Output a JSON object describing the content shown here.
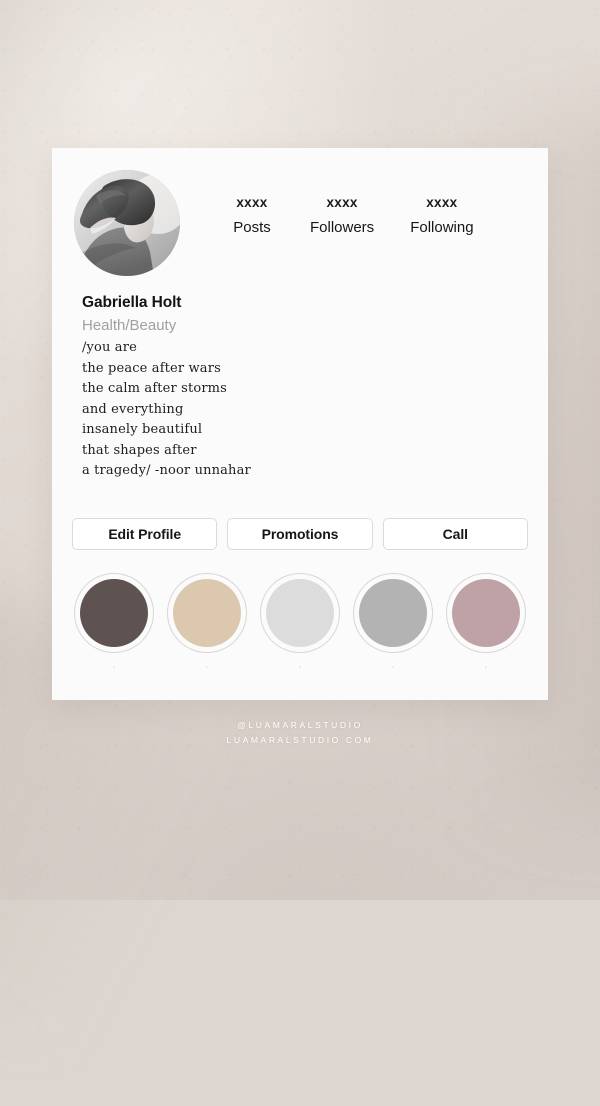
{
  "background": {
    "base_color": "#ded5cf",
    "texture": "paper"
  },
  "profile": {
    "avatar_alt": "profile-photo-woman-back-black-and-white",
    "display_name": "Gabriella Holt",
    "category": "Health/Beauty",
    "bio": "/you are\nthe peace after wars\nthe calm after storms\nand everything\ninsanely beautiful\nthat shapes after\na tragedy/ -noor unnahar",
    "stats": [
      {
        "count": "xxxx",
        "label": "Posts"
      },
      {
        "count": "xxxx",
        "label": "Followers"
      },
      {
        "count": "xxxx",
        "label": "Following"
      }
    ],
    "actions": [
      {
        "label": "Edit Profile"
      },
      {
        "label": "Promotions"
      },
      {
        "label": "Call"
      }
    ],
    "highlights": [
      {
        "color": "#5e5351",
        "label": "·"
      },
      {
        "color": "#dcc8af",
        "label": "·"
      },
      {
        "color": "#dcdcdc",
        "label": "·"
      },
      {
        "color": "#b3b3b3",
        "label": "·"
      },
      {
        "color": "#bfa2a5",
        "label": "·"
      }
    ]
  },
  "watermark": {
    "handle": "@LUAMARALSTUDIO",
    "website": "LUAMARALSTUDIO.COM"
  }
}
